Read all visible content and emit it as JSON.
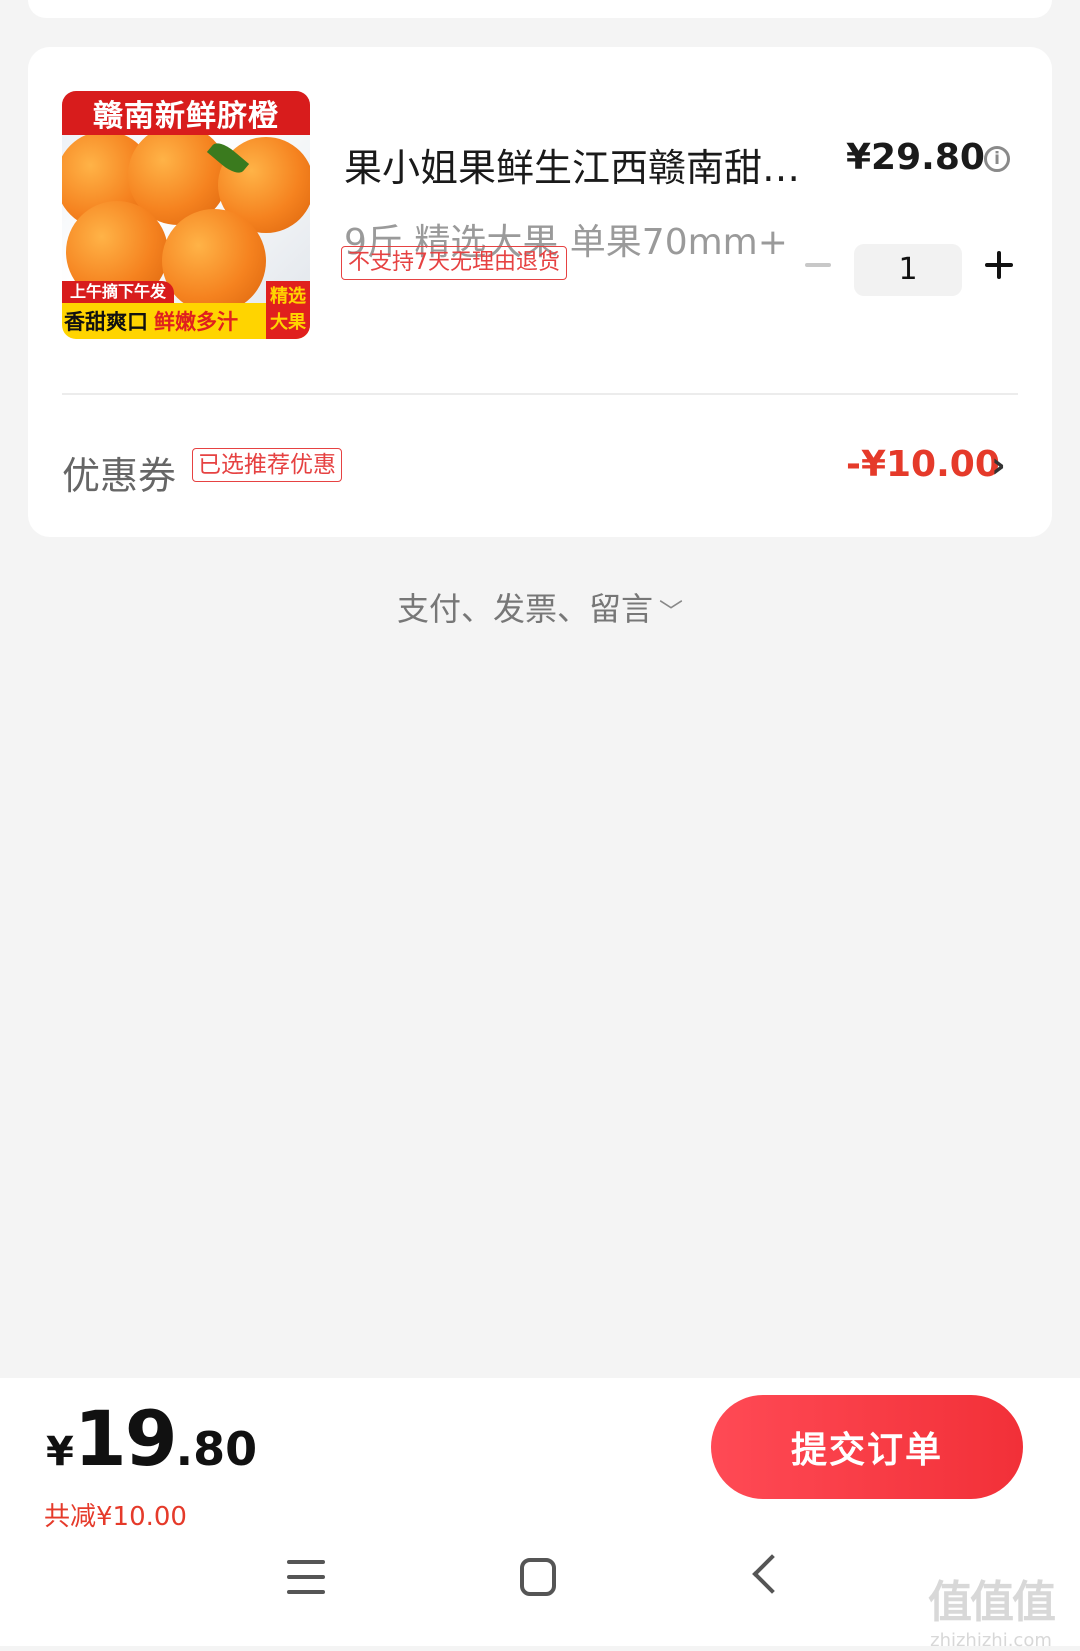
{
  "product": {
    "image_text": {
      "banner": "赣南新鲜脐橙",
      "tag": "上午摘下午发",
      "slogan_a": "香甜爽口",
      "slogan_b": "鲜嫩多汁",
      "corner": "精选大果"
    },
    "title": "果小姐果鲜生江西赣南甜…",
    "price": "¥29.80",
    "spec": "9斤 精选大果 单果70mm+",
    "return_policy": "不支持7天无理由退货",
    "quantity": "1"
  },
  "coupon": {
    "label": "优惠券",
    "badge": "已选推荐优惠",
    "amount": "-¥10.00",
    "chevron": "›"
  },
  "more_options": {
    "label": "支付、发票、留言",
    "chevron": "﹀"
  },
  "footer": {
    "currency": "¥",
    "total_int": "19",
    "total_dec": ".80",
    "discount_text": "共减¥10.00",
    "submit_label": "提交订单"
  },
  "nav": {
    "icons": [
      "menu-icon",
      "home-icon",
      "back-icon"
    ]
  },
  "watermark": {
    "logo": "值值值",
    "site": "zhizhizhi.com"
  },
  "colors": {
    "accent": "#f23038",
    "price_red": "#e53a2a",
    "background": "#f4f4f4"
  }
}
